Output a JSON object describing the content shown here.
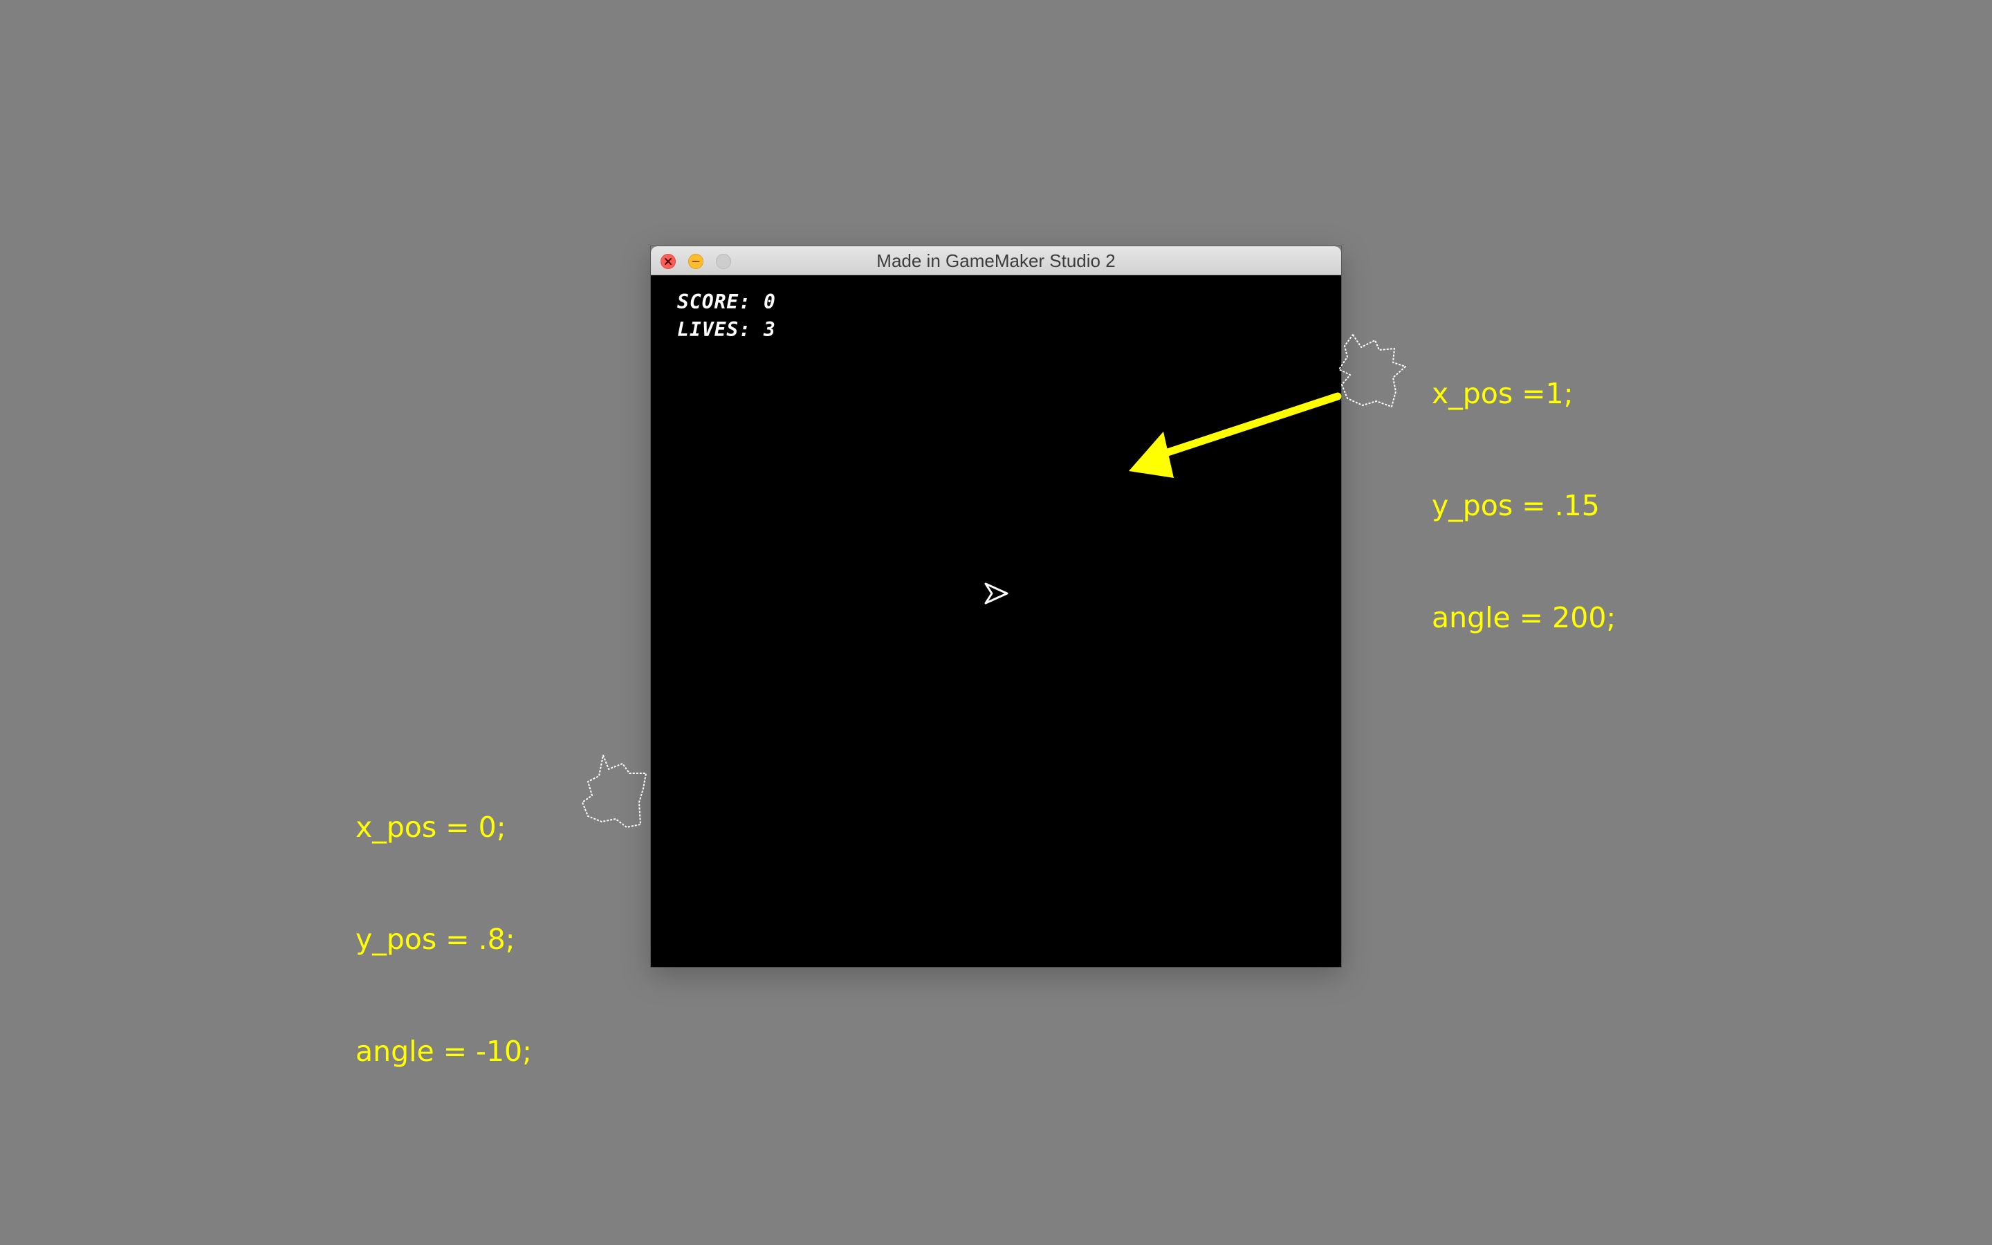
{
  "window": {
    "title": "Made in GameMaker Studio 2"
  },
  "hud": {
    "score_label": "SCORE: 0",
    "lives_label": "LIVES: 3",
    "score": 0,
    "lives": 3
  },
  "annotations": {
    "right": {
      "line1": "x_pos =1;",
      "line2": "y_pos = .15",
      "line3": "angle = 200;"
    },
    "left": {
      "line1": "x_pos = 0;",
      "line2": "y_pos = .8;",
      "line3": "angle = -10;"
    }
  },
  "icons": {
    "window_close": "close-icon",
    "window_minimize": "minimize-icon",
    "window_zoom": "zoom-icon",
    "player": "player-ship-icon",
    "asteroid": "asteroid-icon",
    "pointer_arrow": "arrow-icon"
  },
  "colors": {
    "desktop_background": "#808080",
    "game_background": "#000000",
    "annotation": "#ffff00",
    "hud_text": "#ffffff",
    "close_button": "#fc5f57",
    "minimize_button": "#fdbb2e"
  }
}
